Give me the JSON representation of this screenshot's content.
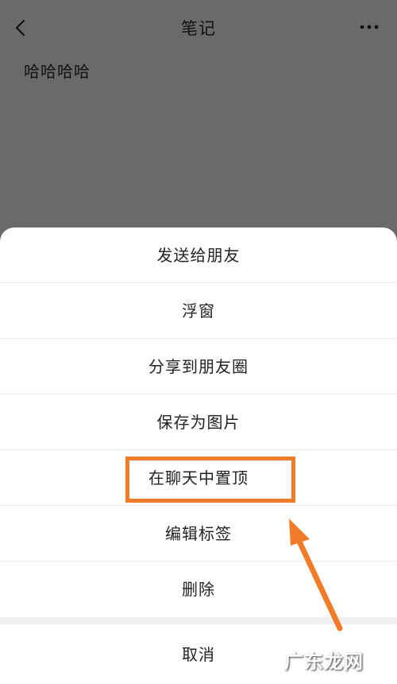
{
  "header": {
    "title": "笔记",
    "back_icon": "chevron-left-icon",
    "more_icon": "more-horizontal-icon"
  },
  "note": {
    "content": "哈哈哈哈"
  },
  "action_sheet": {
    "items": [
      {
        "label": "发送给朋友"
      },
      {
        "label": "浮窗"
      },
      {
        "label": "分享到朋友圈"
      },
      {
        "label": "保存为图片"
      },
      {
        "label": "在聊天中置顶"
      },
      {
        "label": "编辑标签"
      },
      {
        "label": "删除"
      }
    ],
    "cancel_label": "取消"
  },
  "annotation": {
    "color": "#f07c2a",
    "highlighted_item": "在聊天中置顶"
  },
  "watermark": {
    "text": "广东龙网"
  }
}
